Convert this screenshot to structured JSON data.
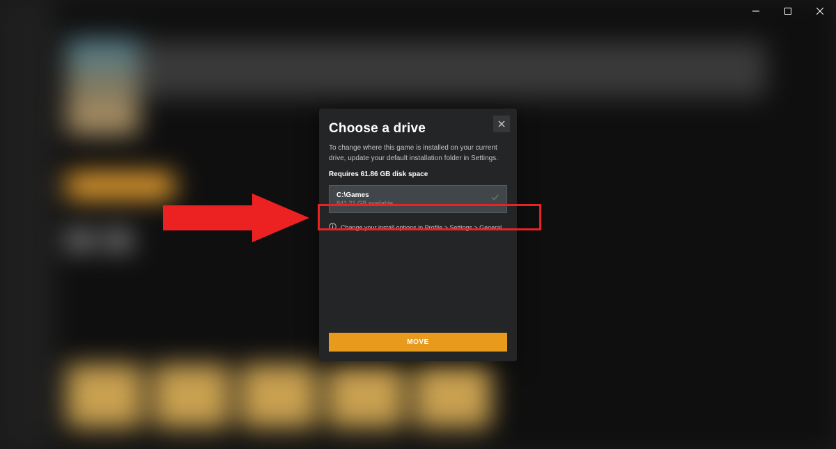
{
  "modal": {
    "title": "Choose a drive",
    "description": "To change where this game is installed on your current drive, update your default installation folder in Settings.",
    "requires": "Requires 61.86 GB disk space",
    "drive": {
      "path": "C:\\Games",
      "available": "841.21 GB available"
    },
    "info_text": "Change your install options in Profile > Settings > General.",
    "move_button": "MOVE"
  }
}
